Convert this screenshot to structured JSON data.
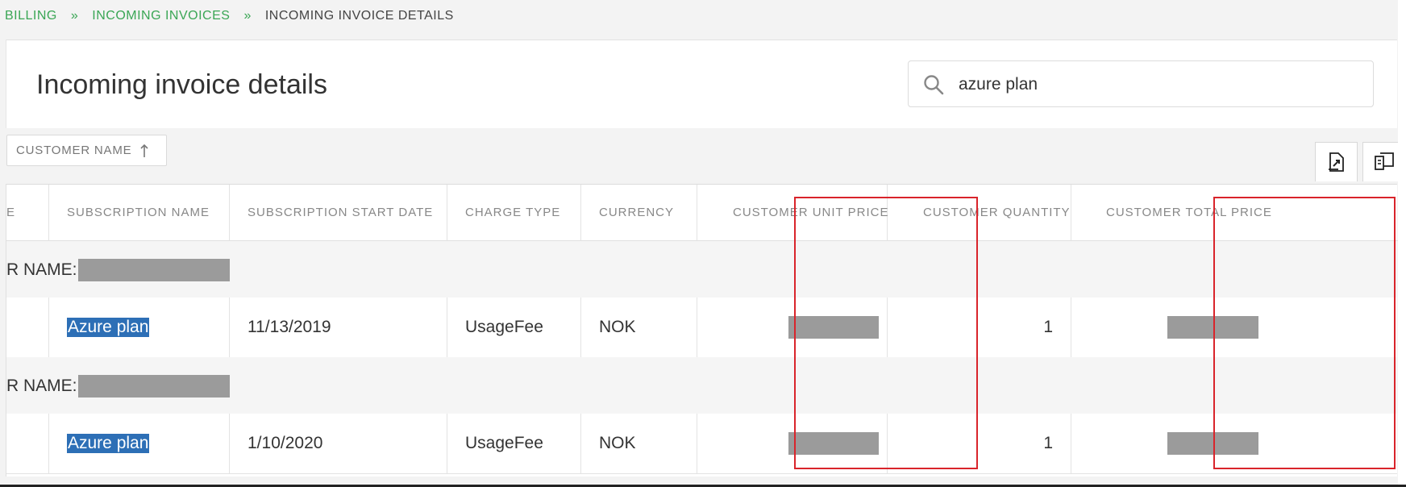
{
  "breadcrumb": {
    "items": [
      "BILLING",
      "INCOMING INVOICES"
    ],
    "separator": "»",
    "current": "INCOMING INVOICE DETAILS"
  },
  "page": {
    "title": "Incoming invoice details"
  },
  "search": {
    "value": "azure plan",
    "icon": "search-icon"
  },
  "grouping": {
    "chip_label": "CUSTOMER NAME",
    "sort_icon": "sort-ascending-icon"
  },
  "toolbar": {
    "export_icon": "export-icon",
    "columns_icon": "columns-icon"
  },
  "table": {
    "columns": [
      "E",
      "SUBSCRIPTION NAME",
      "SUBSCRIPTION START DATE",
      "CHARGE TYPE",
      "CURRENCY",
      "CUSTOMER UNIT PRICE",
      "CUSTOMER QUANTITY",
      "CUSTOMER TOTAL PRICE"
    ],
    "group_prefix": "R NAME:",
    "rows": [
      {
        "subscription_name": "Azure plan",
        "start_date": "11/13/2019",
        "charge_type": "UsageFee",
        "currency": "NOK",
        "quantity": "1"
      },
      {
        "subscription_name": "Azure plan",
        "start_date": "1/10/2020",
        "charge_type": "UsageFee",
        "currency": "NOK",
        "quantity": "1"
      }
    ]
  },
  "colors": {
    "breadcrumb_link": "#3aa655",
    "selection_highlight": "#2d6fb6",
    "annotation_box": "#d9242b",
    "redaction": "#9b9b9b"
  }
}
